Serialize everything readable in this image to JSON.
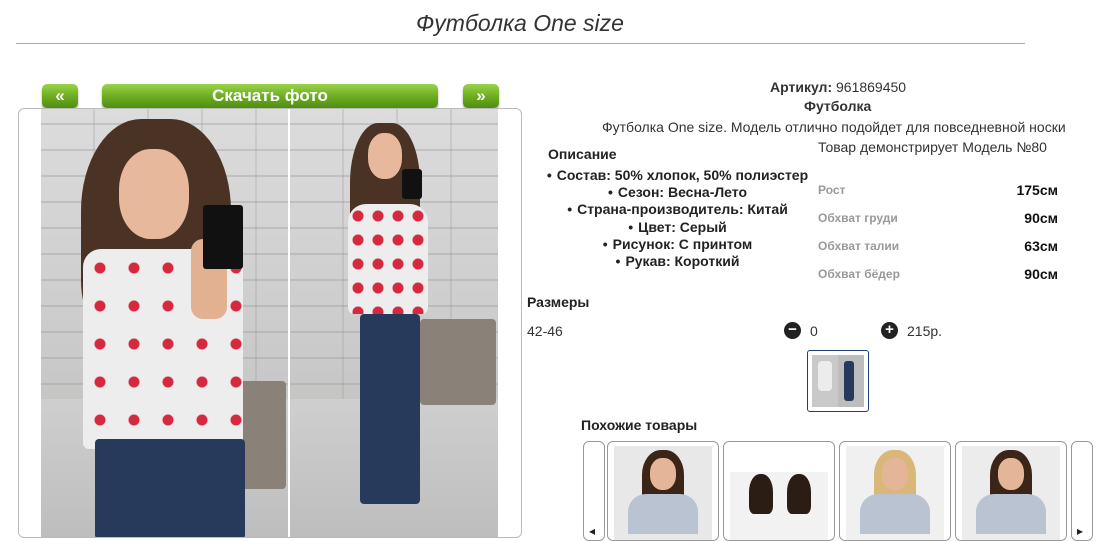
{
  "page_title": "Футболка One size",
  "gallery": {
    "prev_label": "«",
    "next_label": "»",
    "download_label": "Скачать фото"
  },
  "product": {
    "article_label": "Артикул:",
    "article_value": "961869450",
    "category": "Футболка",
    "short_description": "Футболка One size. Модель отлично подойдет для повседневной носки"
  },
  "description": {
    "title": "Описание",
    "items": [
      "Состав: 50% хлопок, 50% полиэстер",
      "Сезон: Весна-Лето",
      "Страна-производитель: Китай",
      "Цвет: Серый",
      "Рисунок: С принтом",
      "Рукав: Короткий"
    ]
  },
  "model": {
    "caption": "Товар демонстрирует Модель №80",
    "measurements": [
      {
        "label": "Рост",
        "value": "175см"
      },
      {
        "label": "Обхват груди",
        "value": "90см"
      },
      {
        "label": "Обхват талии",
        "value": "63см"
      },
      {
        "label": "Обхват бёдер",
        "value": "90см"
      }
    ]
  },
  "sizes": {
    "title": "Размеры",
    "rows": [
      {
        "size": "42-46",
        "quantity": "0",
        "price": "215р."
      }
    ]
  },
  "similar": {
    "title": "Похожие товары",
    "card_colors": [
      "#e8e8e8",
      "#f2f2f2",
      "#f0f0f0",
      "#ececec"
    ],
    "hair_colors": [
      "#3a2518",
      "#2c1d14",
      "#d9b77b",
      "#3a2518"
    ]
  },
  "icons": {
    "minus": "minus-circle-icon",
    "plus": "plus-circle-icon",
    "scroll_left": "chevron-left-icon",
    "scroll_right": "chevron-right-icon"
  },
  "colors": {
    "button_green": "#6bab1f",
    "thumb_border": "#1d3f7a"
  }
}
